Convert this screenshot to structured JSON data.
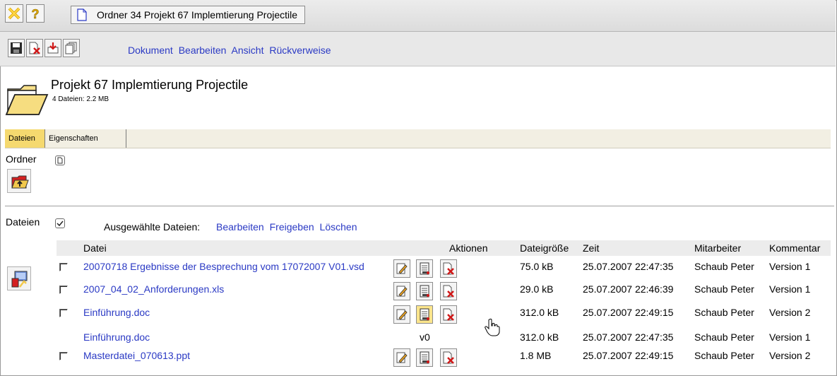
{
  "window": {
    "tab_title": "Ordner 34 Projekt 67 Implemtierung Projectile"
  },
  "menu": [
    "Dokument",
    "Bearbeiten",
    "Ansicht",
    "Rückverweise"
  ],
  "folder": {
    "title": "Projekt 67 Implemtierung Projectile",
    "summary": "4 Dateien: 2.2 MB"
  },
  "tabs": [
    {
      "label": "Dateien",
      "active": true
    },
    {
      "label": "Eigenschaften",
      "active": false
    }
  ],
  "sections": {
    "folders_label": "Ordner",
    "files_label": "Dateien"
  },
  "selection": {
    "label": "Ausgewählte Dateien:",
    "actions": [
      "Bearbeiten",
      "Freigeben",
      "Löschen"
    ]
  },
  "columns": {
    "file": "Datei",
    "actions": "Aktionen",
    "size": "Dateigröße",
    "time": "Zeit",
    "employee": "Mitarbeiter",
    "comment": "Kommentar"
  },
  "files": [
    {
      "name": "20070718 Ergebnisse der Besprechung vom 17072007 V01.vsd",
      "size": "75.0 kB",
      "time": "25.07.2007 22:47:35",
      "employee": "Schaub Peter",
      "comment": "Version 1",
      "checkbox": true,
      "actions": true,
      "version_tag": ""
    },
    {
      "name": "2007_04_02_Anforderungen.xls",
      "size": "29.0 kB",
      "time": "25.07.2007 22:46:39",
      "employee": "Schaub Peter",
      "comment": "Version 1",
      "checkbox": true,
      "actions": true,
      "version_tag": ""
    },
    {
      "name": "Einführung.doc",
      "size": "312.0 kB",
      "time": "25.07.2007 22:49:15",
      "employee": "Schaub Peter",
      "comment": "Version 2",
      "checkbox": true,
      "actions": true,
      "version_tag": ""
    },
    {
      "name": "Einführung.doc",
      "size": "312.0 kB",
      "time": "25.07.2007 22:47:35",
      "employee": "Schaub Peter",
      "comment": "Version 1",
      "checkbox": false,
      "actions": false,
      "version_tag": "v0"
    },
    {
      "name": "Masterdatei_070613.ppt",
      "size": "1.8 MB",
      "time": "25.07.2007 22:49:15",
      "employee": "Schaub Peter",
      "comment": "Version 2",
      "checkbox": true,
      "actions": true,
      "version_tag": ""
    }
  ],
  "colors": {
    "link": "#2a39c4",
    "active_tab": "#f5d96f",
    "tabbar": "#f2efe3"
  }
}
